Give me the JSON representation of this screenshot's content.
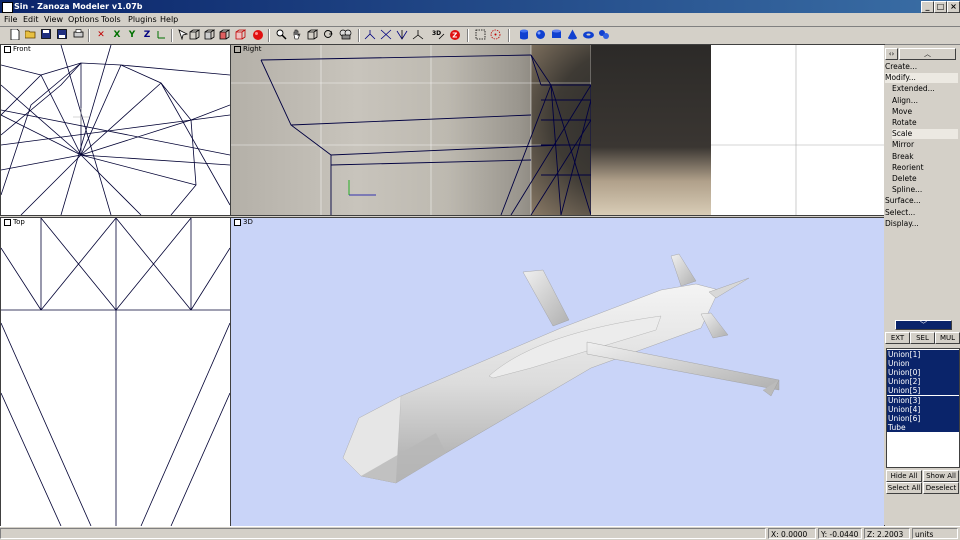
{
  "window": {
    "title": "Sin - Zanoza Modeler v1.07b",
    "controls": [
      "_",
      "□",
      "×"
    ]
  },
  "menu": [
    "File",
    "Edit",
    "View",
    "Options",
    "Tools",
    "Plugins",
    "Help"
  ],
  "toolbar": {
    "axis_x": "X",
    "axis_y": "Y",
    "axis_z": "Z",
    "z_badge": "Z"
  },
  "viewports": {
    "front": "Front",
    "right": "Right",
    "top": "Top",
    "perspective": "3D"
  },
  "panel": {
    "items": [
      {
        "label": "Create...",
        "indent": false
      },
      {
        "label": "Modify...",
        "indent": false
      },
      {
        "label": "Extended...",
        "indent": true
      },
      {
        "label": "Align...",
        "indent": true
      },
      {
        "label": "Move",
        "indent": true
      },
      {
        "label": "Rotate",
        "indent": true
      },
      {
        "label": "Scale",
        "indent": true
      },
      {
        "label": "Mirror",
        "indent": true
      },
      {
        "label": "Break",
        "indent": true
      },
      {
        "label": "Reorient",
        "indent": true
      },
      {
        "label": "Delete",
        "indent": true
      },
      {
        "label": "Spline...",
        "indent": true
      },
      {
        "label": "Surface...",
        "indent": false
      },
      {
        "label": "Select...",
        "indent": false
      },
      {
        "label": "Display...",
        "indent": false
      }
    ],
    "mode_buttons": [
      "EXT",
      "SEL",
      "MUL"
    ],
    "objects": [
      "Union[1]",
      "Union",
      "Union[0]",
      "Union[2]",
      "Union[5]",
      "Union[3]",
      "Union[4]",
      "Union[6]",
      "Tube"
    ],
    "hide_all": "Hide All",
    "show_all": "Show All",
    "select_all": "Select All",
    "deselect": "Deselect"
  },
  "status": {
    "x": "X: 0.0000",
    "y": "Y: -0.0440",
    "z": "Z: 2.2003",
    "units": "units"
  },
  "colors": {
    "titlebar": "#0a246a",
    "viewport3d_bg": "#c9d4f8",
    "selection": "#0a246a",
    "wire": "#000033"
  }
}
